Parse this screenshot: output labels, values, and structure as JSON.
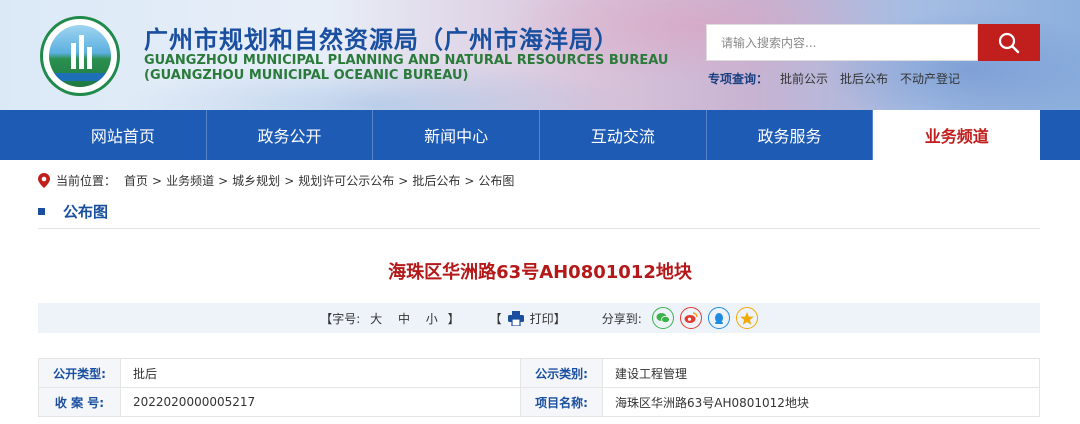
{
  "header": {
    "title_cn": "广州市规划和自然资源局（广州市海洋局）",
    "title_en_line1": "GUANGZHOU MUNICIPAL PLANNING AND NATURAL RESOURCES BUREAU",
    "title_en_line2": "(GUANGZHOU MUNICIPAL OCEANIC BUREAU)",
    "search_placeholder": "请输入搜索内容...",
    "quick_label": "专项查询：",
    "quick_links": [
      "批前公示",
      "批后公布",
      "不动产登记"
    ]
  },
  "nav": {
    "items": [
      "网站首页",
      "政务公开",
      "新闻中心",
      "互动交流",
      "政务服务",
      "业务频道"
    ],
    "active_index": 5
  },
  "breadcrumb": {
    "label": "当前位置：",
    "items": [
      "首页",
      "业务频道",
      "城乡规划",
      "规划许可公示公布",
      "批后公布",
      "公布图"
    ],
    "separator": ">"
  },
  "section": {
    "title": "公布图"
  },
  "document": {
    "title": "海珠区华洲路63号AH0801012地块",
    "font_size_label": "【字号:",
    "font_sizes": [
      "大",
      "中",
      "小"
    ],
    "font_size_close": "】",
    "print_open": "【",
    "print_label": "打印",
    "print_close": "】",
    "share_label": "分享到:"
  },
  "info_table": {
    "rows": [
      {
        "l1": "公开类型:",
        "v1": "批后",
        "l2": "公示类别:",
        "v2": "建设工程管理"
      },
      {
        "l1": "收 案 号:",
        "v1": "2022020000005217",
        "l2": "项目名称:",
        "v2": "海珠区华洲路63号AH0801012地块"
      }
    ]
  },
  "colors": {
    "nav_bg": "#1d5bb5",
    "accent_red": "#c11e1e",
    "title_red": "#b41818",
    "brand_blue": "#1a4fa0"
  },
  "icons": [
    "search-icon",
    "location-pin-icon",
    "printer-icon",
    "wechat-icon",
    "weibo-icon",
    "qq-icon",
    "qzone-icon"
  ]
}
